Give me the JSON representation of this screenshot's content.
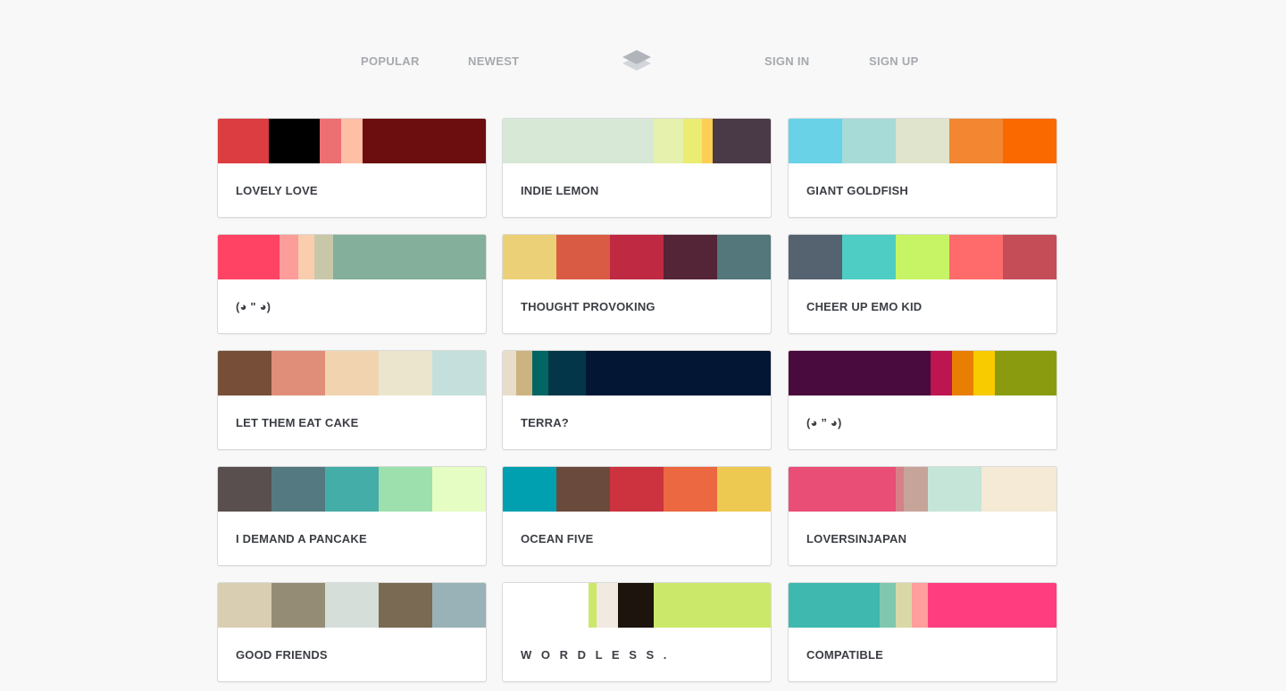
{
  "nav": {
    "popular": "POPULAR",
    "newest": "NEWEST",
    "sign_in": "SIGN IN",
    "sign_up": "SIGN UP",
    "logo_icon": "layers-icon",
    "link_color": "#a6a9ae"
  },
  "palettes": [
    {
      "title": "LOVELY LOVE",
      "colors": [
        "#dc3d40",
        "#000000",
        "#ec6f72",
        "#ffbfa5",
        "#6c0e0f"
      ],
      "widths": [
        57,
        57,
        24,
        24,
        138
      ]
    },
    {
      "title": "INDIE LEMON",
      "colors": [
        "#d8e8d6",
        "#e5f1ad",
        "#ebec72",
        "#fbcf54",
        "#4a3946"
      ],
      "widths": [
        169,
        33,
        21,
        12,
        65
      ]
    },
    {
      "title": "GIANT GOLDFISH",
      "colors": [
        "#69d2e7",
        "#a7dbd8",
        "#e0e4cc",
        "#f38630",
        "#fa6900"
      ],
      "widths": [
        60,
        60,
        60,
        60,
        60
      ]
    },
    {
      "title": "(◕ \" ◕)",
      "colors": [
        "#fe4365",
        "#fc9d9a",
        "#f9cdad",
        "#c8c8a9",
        "#83af9b"
      ],
      "widths": [
        69,
        21,
        18,
        21,
        171
      ]
    },
    {
      "title": "THOUGHT PROVOKING",
      "colors": [
        "#ecd078",
        "#d95b43",
        "#c02942",
        "#542437",
        "#53777a"
      ],
      "widths": [
        60,
        60,
        60,
        60,
        60
      ]
    },
    {
      "title": "CHEER UP EMO KID",
      "colors": [
        "#556270",
        "#4ecdc4",
        "#c7f464",
        "#ff6b6b",
        "#c44d58"
      ],
      "widths": [
        60,
        60,
        60,
        60,
        60
      ]
    },
    {
      "title": "LET THEM EAT CAKE",
      "colors": [
        "#774f38",
        "#e08e79",
        "#f1d4af",
        "#ece5ce",
        "#c5e0dc"
      ],
      "widths": [
        60,
        60,
        60,
        60,
        60
      ]
    },
    {
      "title": "TERRA?",
      "colors": [
        "#e8ddcb",
        "#cdb380",
        "#036564",
        "#033649",
        "#031634"
      ],
      "widths": [
        15,
        18,
        18,
        42,
        207
      ]
    },
    {
      "title": "(◕ ” ◕)",
      "colors": [
        "#490a3d",
        "#bd1550",
        "#e97f02",
        "#f8ca00",
        "#8a9b0f"
      ],
      "widths": [
        159,
        24,
        24,
        24,
        69
      ]
    },
    {
      "title": "I DEMAND A PANCAKE",
      "colors": [
        "#594f4f",
        "#547980",
        "#45ada8",
        "#9de0ad",
        "#e5fcc2"
      ],
      "widths": [
        60,
        60,
        60,
        60,
        60
      ]
    },
    {
      "title": "OCEAN FIVE",
      "colors": [
        "#00a0b0",
        "#6a4a3c",
        "#cc333f",
        "#eb6841",
        "#edc951"
      ],
      "widths": [
        60,
        60,
        60,
        60,
        60
      ]
    },
    {
      "title": "LOVERSINJAPAN",
      "colors": [
        "#e94e77",
        "#d68189",
        "#c6a49a",
        "#c6e5d9",
        "#f4ead5"
      ],
      "widths": [
        120,
        9,
        27,
        60,
        84
      ]
    },
    {
      "title": "GOOD FRIENDS",
      "colors": [
        "#d9ceb2",
        "#948c75",
        "#d5ded9",
        "#7a6a53",
        "#99b2b7"
      ],
      "widths": [
        60,
        60,
        60,
        60,
        60
      ]
    },
    {
      "title": "W O R D L E S S .",
      "colors": [
        "#ffffff",
        "#cbe86b",
        "#f2e9e1",
        "#1c140d",
        "#cbe86b"
      ],
      "widths": [
        96,
        9,
        24,
        40,
        131
      ]
    },
    {
      "title": "COMPATIBLE",
      "colors": [
        "#3fb8af",
        "#7fc7af",
        "#dad8a7",
        "#ff9e9d",
        "#ff3d7f"
      ],
      "widths": [
        102,
        18,
        18,
        18,
        144
      ]
    }
  ]
}
